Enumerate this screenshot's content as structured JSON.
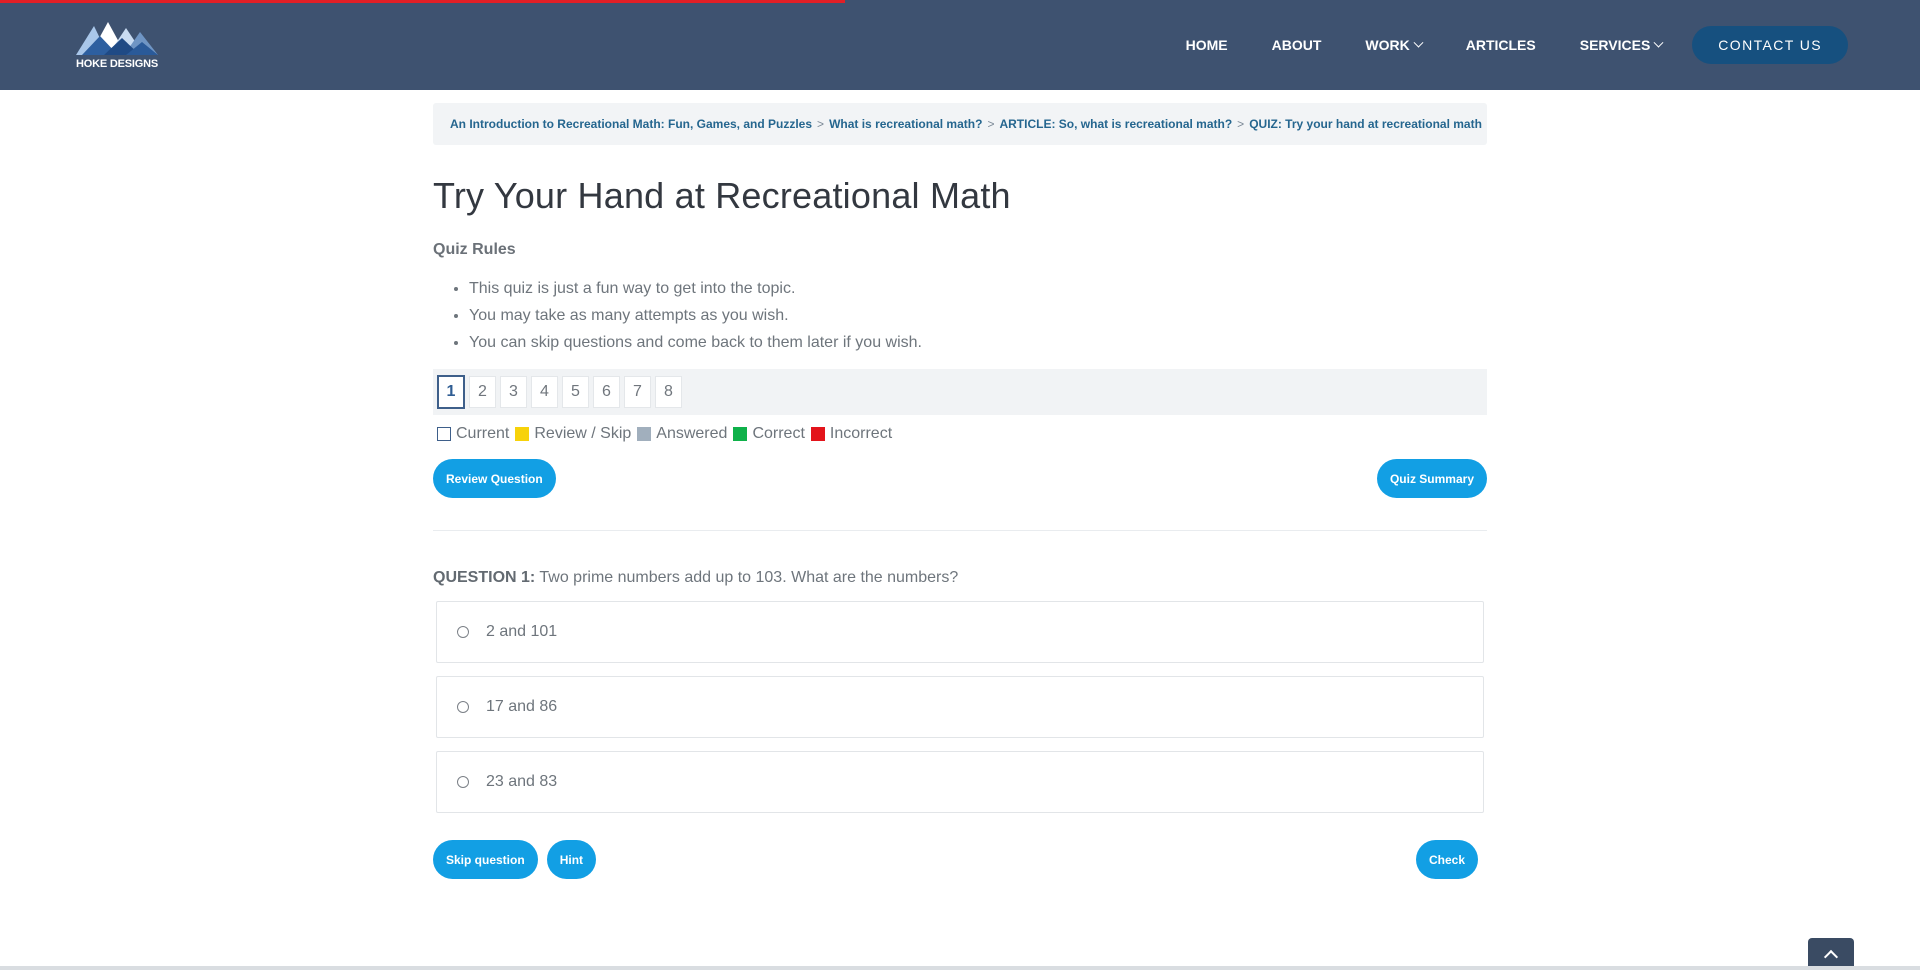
{
  "progress": {
    "fraction": 0.44,
    "color": "#e21f26"
  },
  "header": {
    "logo_text": "HOKE DESIGNS",
    "nav": [
      {
        "label": "HOME",
        "dropdown": false
      },
      {
        "label": "ABOUT",
        "dropdown": false
      },
      {
        "label": "WORK",
        "dropdown": true
      },
      {
        "label": "ARTICLES",
        "dropdown": false
      },
      {
        "label": "SERVICES",
        "dropdown": true
      }
    ],
    "contact_label": "CONTACT US",
    "colors": {
      "background": "#3e5270",
      "contact_button": "#16507f"
    }
  },
  "breadcrumb": [
    "An Introduction to Recreational Math: Fun, Games, and Puzzles",
    "What is recreational math?",
    "ARTICLE: So, what is recreational math?",
    "QUIZ: Try your hand at recreational math"
  ],
  "breadcrumb_sep": ">",
  "page_title": "Try Your Hand at Recreational Math",
  "rules": {
    "heading": "Quiz Rules",
    "items": [
      "This quiz is just a fun way to get into the topic.",
      "You may take as many attempts as you wish.",
      "You can skip questions and come back to them later if you wish."
    ]
  },
  "question_nav": {
    "numbers": [
      "1",
      "2",
      "3",
      "4",
      "5",
      "6",
      "7",
      "8"
    ],
    "current": "1"
  },
  "legend": [
    {
      "label": "Current",
      "color": "#ffffff",
      "outline": true
    },
    {
      "label": "Review / Skip",
      "color": "#f7d20a",
      "outline": false
    },
    {
      "label": "Answered",
      "color": "#a1afbd",
      "outline": false
    },
    {
      "label": "Correct",
      "color": "#0fb14a",
      "outline": false
    },
    {
      "label": "Incorrect",
      "color": "#e3141b",
      "outline": false
    }
  ],
  "buttons": {
    "review": "Review Question",
    "summary": "Quiz Summary",
    "skip": "Skip question",
    "hint": "Hint",
    "check": "Check",
    "accent": "#129fe4"
  },
  "question": {
    "label": "QUESTION 1:",
    "text": "Two prime numbers add up to 103. What are the numbers?",
    "answers": [
      "2 and 101",
      "17 and 86",
      "23 and 83"
    ]
  }
}
